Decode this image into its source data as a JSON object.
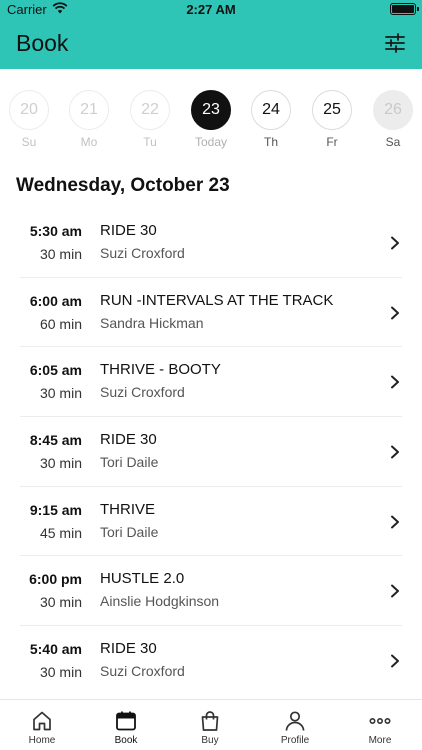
{
  "status_bar": {
    "carrier": "Carrier",
    "time": "2:27 AM"
  },
  "nav": {
    "title": "Book",
    "filter_icon": "sliders-icon"
  },
  "week": [
    {
      "num": "20",
      "label": "Su",
      "state": "past"
    },
    {
      "num": "21",
      "label": "Mo",
      "state": "past"
    },
    {
      "num": "22",
      "label": "Tu",
      "state": "past"
    },
    {
      "num": "23",
      "label": "Today",
      "state": "today"
    },
    {
      "num": "24",
      "label": "Th",
      "state": "future"
    },
    {
      "num": "25",
      "label": "Fr",
      "state": "future"
    },
    {
      "num": "26",
      "label": "Sa",
      "state": "muted"
    }
  ],
  "date_heading": "Wednesday, October 23",
  "classes": [
    {
      "time": "5:30 am",
      "duration": "30 min",
      "name": "RIDE 30",
      "coach": "Suzi Croxford"
    },
    {
      "time": "6:00 am",
      "duration": "60 min",
      "name": "RUN -INTERVALS AT THE TRACK",
      "coach": "Sandra Hickman"
    },
    {
      "time": "6:05 am",
      "duration": "30 min",
      "name": "THRIVE - BOOTY",
      "coach": "Suzi Croxford"
    },
    {
      "time": "8:45 am",
      "duration": "30 min",
      "name": "RIDE 30",
      "coach": "Tori Daile"
    },
    {
      "time": "9:15 am",
      "duration": "45 min",
      "name": "THRIVE",
      "coach": "Tori Daile"
    },
    {
      "time": "6:00 pm",
      "duration": "30 min",
      "name": "HUSTLE 2.0",
      "coach": "Ainslie Hodgkinson"
    },
    {
      "time": "5:40 am",
      "duration": "30 min",
      "name": "RIDE 30",
      "coach": "Suzi Croxford"
    }
  ],
  "tabs": [
    {
      "label": "Home",
      "icon": "home-icon"
    },
    {
      "label": "Book",
      "icon": "calendar-icon",
      "active": true
    },
    {
      "label": "Buy",
      "icon": "shopping-bag-icon"
    },
    {
      "label": "Profile",
      "icon": "person-icon"
    },
    {
      "label": "More",
      "icon": "ellipsis-icon"
    }
  ],
  "colors": {
    "accent": "#2ec4b6",
    "today": "#111111"
  }
}
